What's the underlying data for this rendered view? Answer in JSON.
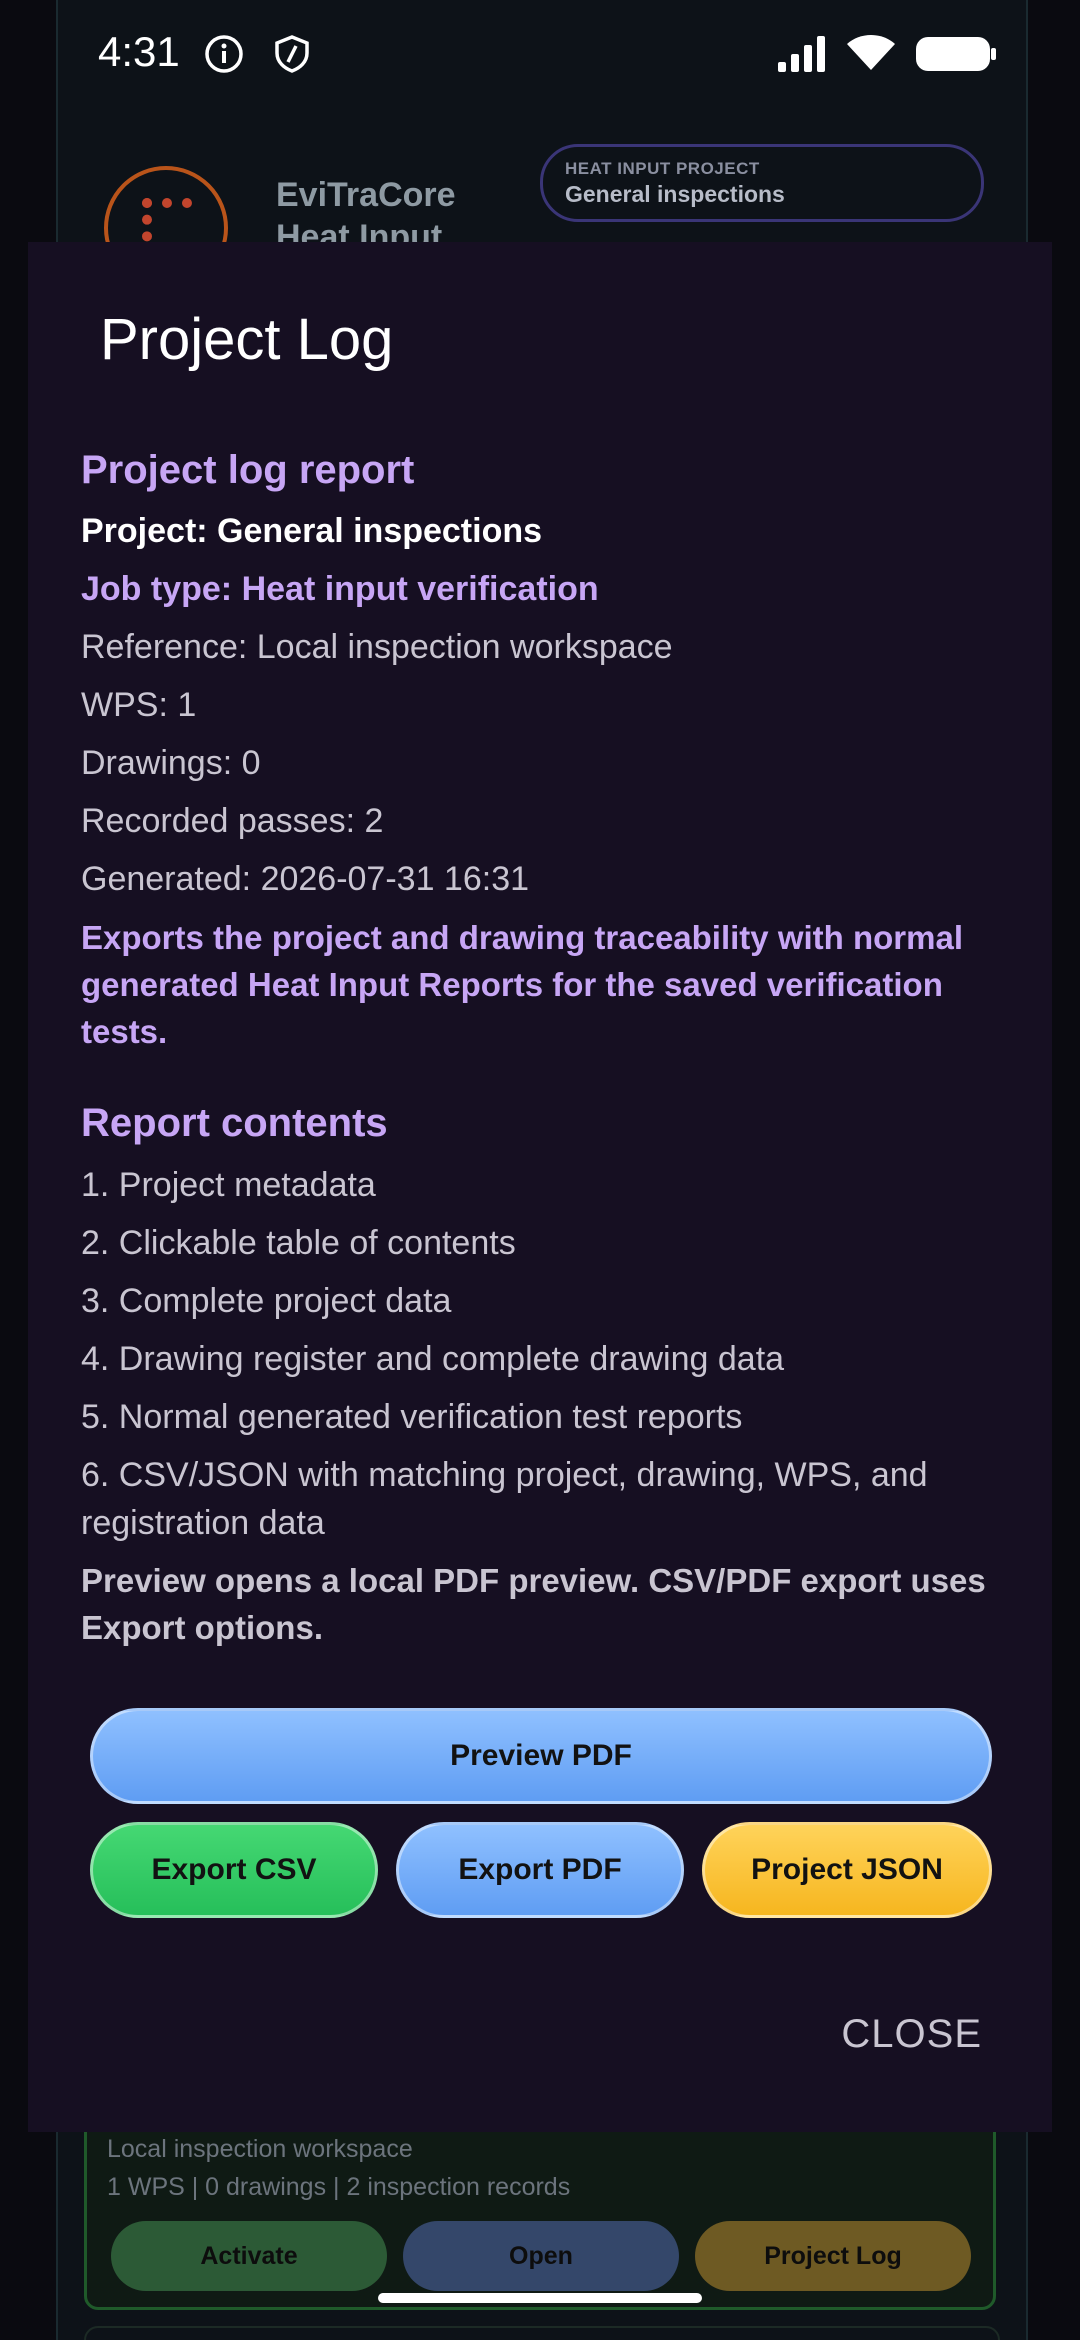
{
  "status_bar": {
    "time": "4:31",
    "icons": [
      "info-icon",
      "shield-icon",
      "signal-icon",
      "wifi-icon",
      "battery-icon"
    ]
  },
  "background_app": {
    "app_title_line1": "EviTraCore",
    "app_title_line2": "Heat Input",
    "project_pill": {
      "label": "HEAT INPUT PROJECT",
      "value": "General inspections"
    },
    "card": {
      "reference": "Local inspection workspace",
      "summary": "1 WPS | 0 drawings | 2 inspection records",
      "buttons": {
        "activate": "Activate",
        "open": "Open",
        "project_log": "Project Log"
      }
    }
  },
  "dialog": {
    "title": "Project Log",
    "report": {
      "heading": "Project log report",
      "project": "Project: General inspections",
      "job_type": "Job type: Heat input verification",
      "reference": "Reference: Local inspection workspace",
      "wps": "WPS: 1",
      "drawings": "Drawings: 0",
      "recorded_passes": "Recorded passes: 2",
      "generated": "Generated: 2026-07-31 16:31",
      "description": "Exports the project and drawing traceability with normal generated Heat Input Reports for the saved verification tests."
    },
    "contents": {
      "heading": "Report contents",
      "items": [
        "1. Project metadata",
        "2. Clickable table of contents",
        "3. Complete project data",
        "4. Drawing register and complete drawing data",
        "5. Normal generated verification test reports",
        "6. CSV/JSON with matching project, drawing, WPS, and registration data"
      ],
      "note": "Preview opens a local PDF preview. CSV/PDF export uses Export options."
    },
    "buttons": {
      "preview_pdf": "Preview PDF",
      "export_csv": "Export CSV",
      "export_pdf": "Export PDF",
      "project_json": "Project JSON",
      "close": "CLOSE"
    }
  },
  "colors": {
    "dialog_bg": "#160f22",
    "accent_purple": "#c7a6f5",
    "blue": "#6aa6f6",
    "green": "#2fcb64",
    "yellow": "#f8c02e"
  }
}
